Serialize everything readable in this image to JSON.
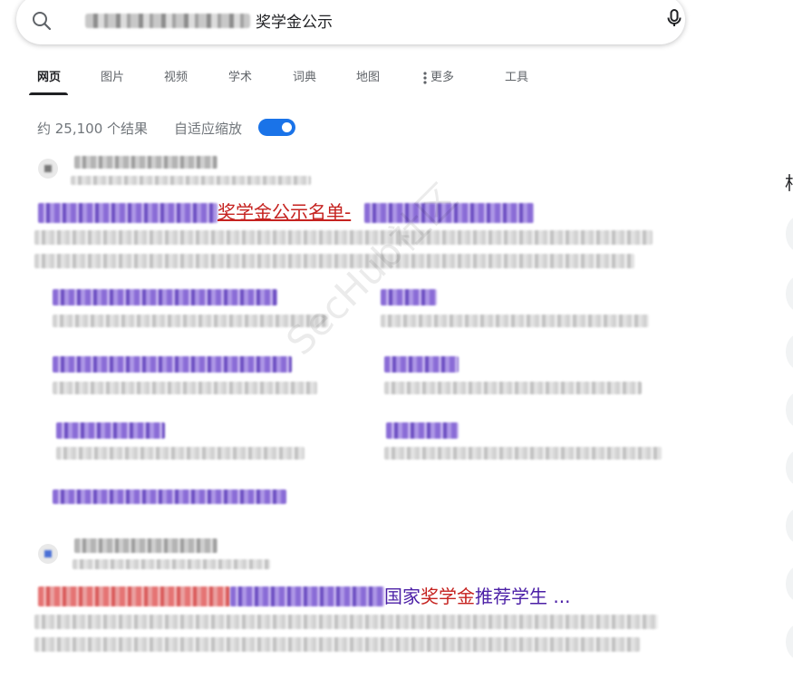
{
  "search": {
    "query_visible": "奖学金公示"
  },
  "tabs": [
    {
      "label": "网页",
      "active": true
    },
    {
      "label": "图片"
    },
    {
      "label": "视频"
    },
    {
      "label": "学术"
    },
    {
      "label": "词典"
    },
    {
      "label": "地图"
    },
    {
      "label": "更多"
    },
    {
      "label": "工具"
    }
  ],
  "results_info": {
    "count_text": "约 25,100 个结果",
    "zoom_label": "自适应缩放",
    "zoom_enabled": true
  },
  "results": [
    {
      "title_visible": "奖学金公示名单-",
      "title_color": "#c5221f"
    },
    {
      "title_prefix": "国家",
      "title_highlight": "奖学金",
      "title_suffix": "推荐学生 ...",
      "title_color": "#4b1fa6",
      "highlight_color": "#c5221f"
    }
  ],
  "watermark": "SecHub社区",
  "right_panel": {
    "partial_char": "相"
  },
  "colors": {
    "accent": "#1a73e8",
    "link_red": "#c5221f",
    "link_purple": "#4b1fa6"
  }
}
